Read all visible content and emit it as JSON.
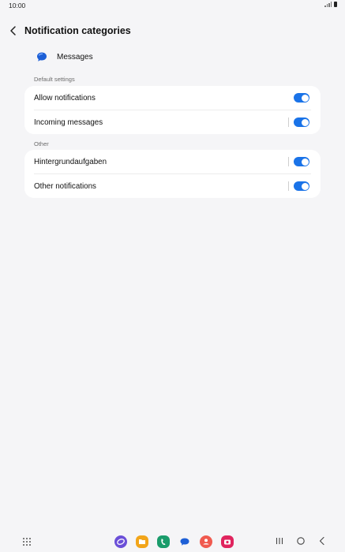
{
  "status_bar": {
    "time": "10:00"
  },
  "header": {
    "title": "Notification categories"
  },
  "app": {
    "name": "Messages",
    "icon": "messages-icon"
  },
  "sections": [
    {
      "label": "Default settings",
      "rows": [
        {
          "label": "Allow notifications",
          "enabled": true
        },
        {
          "label": "Incoming messages",
          "enabled": true
        }
      ]
    },
    {
      "label": "Other",
      "rows": [
        {
          "label": "Hintergrundaufgaben",
          "enabled": true
        },
        {
          "label": "Other notifications",
          "enabled": true
        }
      ]
    }
  ],
  "dock": [
    {
      "name": "internet-icon",
      "color": "#6b4fd8"
    },
    {
      "name": "my-files-icon",
      "color": "#f2a51a"
    },
    {
      "name": "phone-icon",
      "color": "#1a9c6b"
    },
    {
      "name": "messages-icon",
      "color": "#1d5fd6"
    },
    {
      "name": "contacts-icon",
      "color": "#f05a4f"
    },
    {
      "name": "camera-icon",
      "color": "#e0245e"
    }
  ],
  "colors": {
    "accent": "#1a73e8",
    "background": "#f5f5f7"
  }
}
